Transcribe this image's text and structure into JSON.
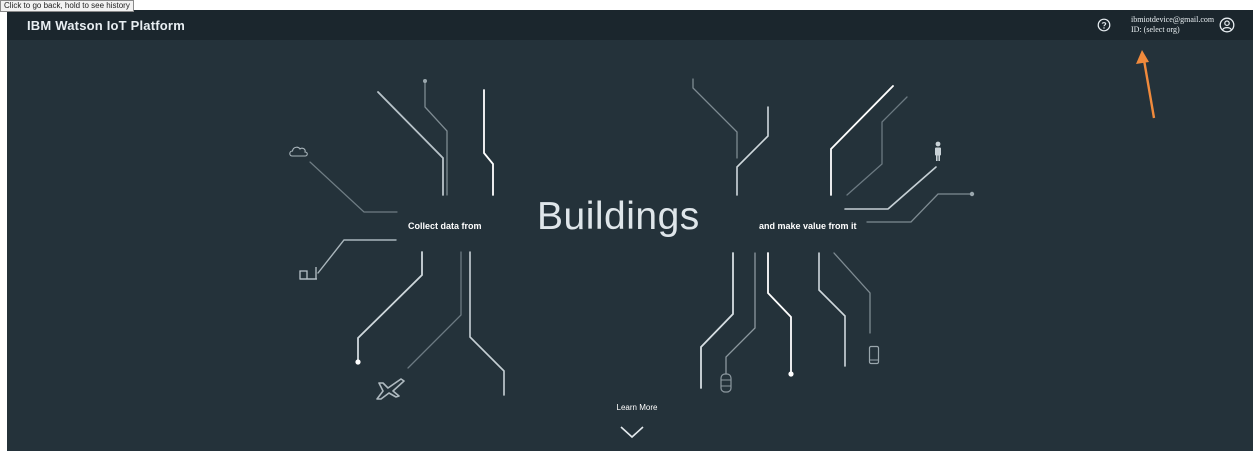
{
  "browser": {
    "back_tooltip": "Click to go back, hold to see history"
  },
  "header": {
    "title": "IBM Watson IoT Platform",
    "help_icon": "help-circle-icon",
    "user_email": "ibmiotdevice@gmail.com",
    "org_id": "ID: (select org)",
    "avatar_icon": "user-avatar-icon"
  },
  "hero": {
    "heading": "Buildings",
    "left_caption": "Collect data from",
    "right_caption": "and make value from it",
    "learn_more": "Learn More",
    "icons": [
      "cloud-icon",
      "factory-icon",
      "airplane-icon",
      "car-icon",
      "person-icon",
      "mobile-phone-icon",
      "chevron-down-icon"
    ]
  },
  "annotation": {
    "arrow_color": "#f08a3c",
    "icon": "orange-arrow-annotation"
  }
}
